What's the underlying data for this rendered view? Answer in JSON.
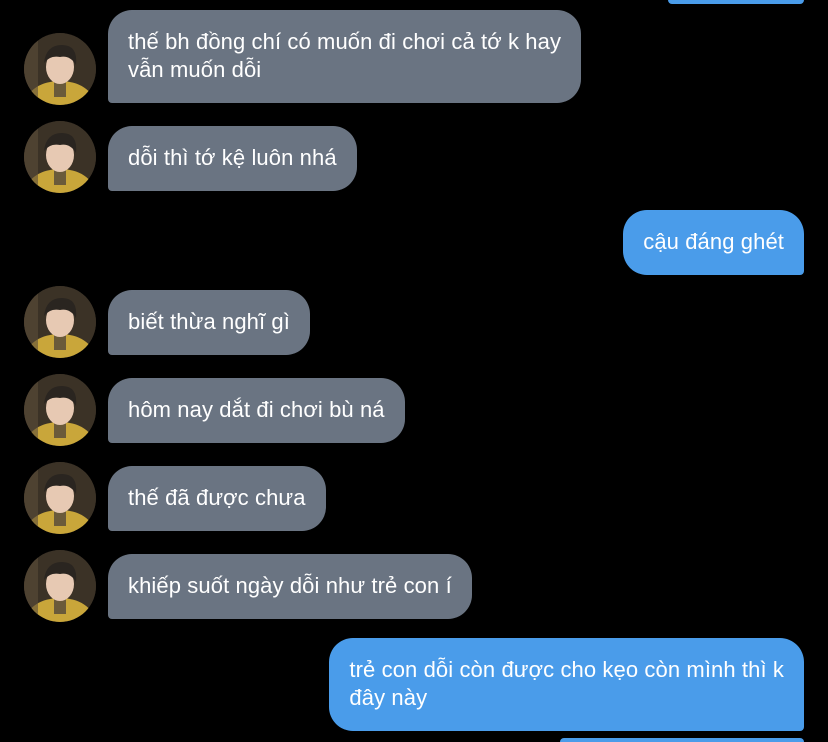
{
  "colors": {
    "background": "#000000",
    "incoming_bubble": "#6a7482",
    "outgoing_bubble": "#4a9cea",
    "text": "#ffffff"
  },
  "contact": {
    "avatar_icon": "contact-avatar-photo"
  },
  "messages": [
    {
      "direction": "incoming",
      "lines": [
        "thế bh đồng chí có muốn đi chơi cả tớ k hay",
        "vẫn muốn dỗi"
      ]
    },
    {
      "direction": "incoming",
      "lines": [
        "dỗi thì tớ kệ luôn nhá"
      ]
    },
    {
      "direction": "outgoing",
      "lines": [
        "cậu đáng ghét"
      ]
    },
    {
      "direction": "incoming",
      "lines": [
        "biết thừa nghĩ gì"
      ]
    },
    {
      "direction": "incoming",
      "lines": [
        "hôm nay dắt đi chơi bù ná"
      ]
    },
    {
      "direction": "incoming",
      "lines": [
        "thế đã được chưa"
      ]
    },
    {
      "direction": "incoming",
      "lines": [
        "khiếp suốt ngày dỗi như trẻ con í"
      ]
    },
    {
      "direction": "outgoing",
      "lines": [
        "trẻ con dỗi còn được cho kẹo còn mình thì k",
        "đây này"
      ]
    }
  ]
}
